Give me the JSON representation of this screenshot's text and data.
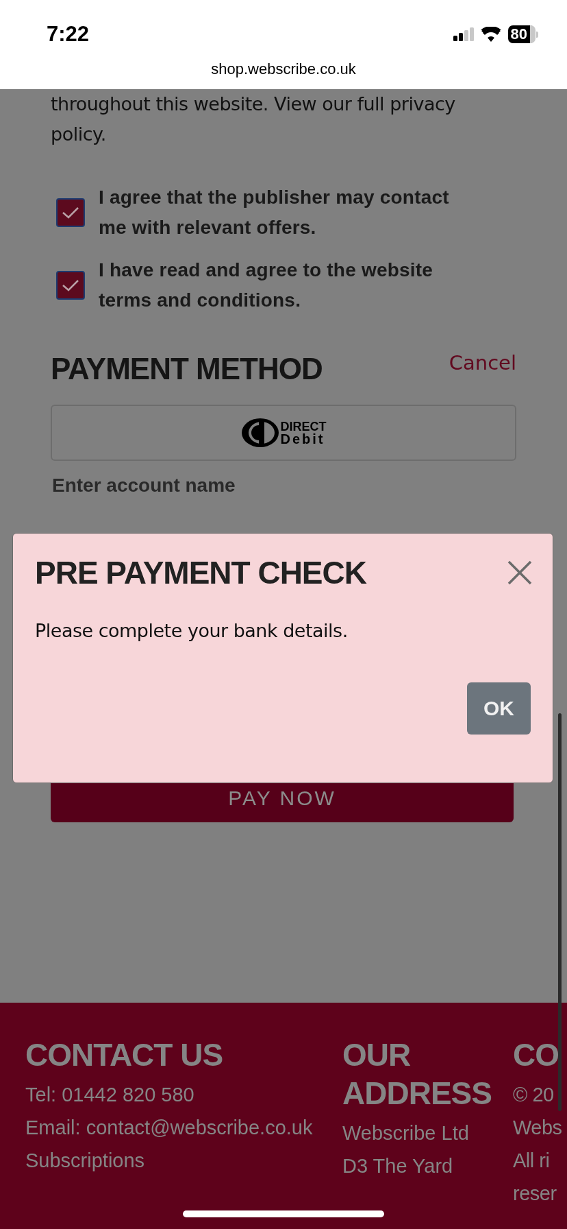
{
  "status_bar": {
    "time": "7:22",
    "battery": "80"
  },
  "address_bar": {
    "url": "shop.webscribe.co.uk"
  },
  "intro_text": "throughout this website. View our full privacy policy.",
  "consents": [
    {
      "label": "I agree that the publisher may contact me with relevant offers.",
      "checked": true
    },
    {
      "label": "I have read and agree to the website terms and conditions.",
      "checked": true
    }
  ],
  "payment": {
    "title": "PAYMENT METHOD",
    "cancel": "Cancel",
    "logo_line_1": "DIRECT",
    "logo_line_2": "Debit",
    "account_name_label": "Enter account name",
    "pay_button": "PAY NOW"
  },
  "dialog": {
    "title": "PRE PAYMENT CHECK",
    "message": "Please complete your bank details.",
    "ok_button": "OK"
  },
  "footer": {
    "columns": [
      {
        "title": "CONTACT US",
        "lines": [
          "Tel: 01442 820 580",
          "Email: contact@webscribe.co.uk",
          "Subscriptions"
        ]
      },
      {
        "title": "OUR ADDRESS",
        "lines": [
          "Webscribe Ltd",
          "D3 The Yard"
        ]
      },
      {
        "title": "CO",
        "lines": [
          "© 20",
          "Webs",
          "All ri",
          "reser"
        ]
      }
    ]
  }
}
